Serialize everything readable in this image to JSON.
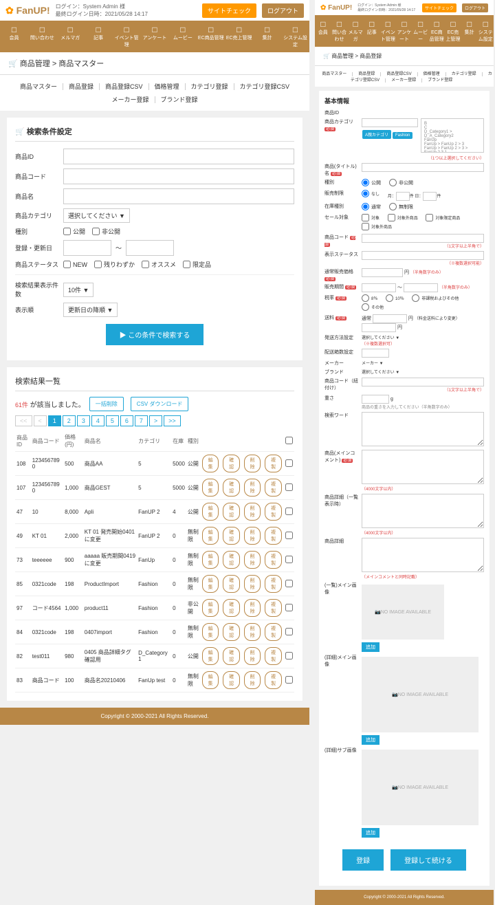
{
  "header": {
    "logo": "FanUP!",
    "login_user": "ログイン：System Admin 様",
    "login_time": "最終ログイン日時：2021/05/28 14:17",
    "btn_check": "サイトチェック",
    "btn_logout": "ログアウト"
  },
  "nav": [
    "会員",
    "問い合わせ",
    "メルマガ",
    "記事",
    "イベント管理",
    "アンケート",
    "ムービー",
    "EC商品管理",
    "EC売上管理",
    "集計",
    "システム設定"
  ],
  "breadcrumb": "商品管理 > 商品マスター",
  "tabs_row1": [
    "商品マスター",
    "商品登録",
    "商品登録CSV",
    "価格管理",
    "カテゴリ登録",
    "カテゴリ登録CSV"
  ],
  "tabs_row2": [
    "メーカー登録",
    "ブランド登録"
  ],
  "search": {
    "title": "検索条件設定",
    "l_id": "商品ID",
    "l_code": "商品コード",
    "l_name": "商品名",
    "l_cat": "商品カテゴリ",
    "cat_ph": "選択してください ▼",
    "l_type": "種別",
    "type_pub": "公開",
    "type_unpub": "非公開",
    "l_date": "登録・更新日",
    "dash": "〜",
    "l_status": "商品ステータス",
    "st_new": "NEW",
    "st_few": "残りわずか",
    "st_rec": "オススメ",
    "st_lim": "限定品",
    "l_count": "検索結果表示件数",
    "count_v": "10件 ▼",
    "l_sort": "表示順",
    "sort_v": "更新日の降順 ▼",
    "submit": "▶ この条件で検索する"
  },
  "results": {
    "title": "検索結果一覧",
    "hit_n": "61件",
    "hit_t": " が該当しました。",
    "btn_bulk": "一括削除",
    "btn_csv": "CSV ダウンロード",
    "pager": [
      "<<",
      "<",
      "1",
      "2",
      "3",
      "4",
      "5",
      "6",
      "7",
      ">",
      ">>"
    ],
    "cols": [
      "商品ID",
      "商品コード",
      "価格(円)",
      "商品名",
      "カテゴリ",
      "在庫",
      "種別"
    ],
    "btns": [
      "編集",
      "確認",
      "削除",
      "複製"
    ],
    "rows": [
      {
        "id": "108",
        "code": "123456789 0",
        "price": "500",
        "name": "商品AA",
        "cat": "5",
        "stock": "5000",
        "type": "公開"
      },
      {
        "id": "107",
        "code": "123456789 0",
        "price": "1,000",
        "name": "商品GEST",
        "cat": "5",
        "stock": "5000",
        "type": "公開"
      },
      {
        "id": "47",
        "code": "10",
        "price": "8,000",
        "name": "Apli",
        "cat": "FanUP 2",
        "stock": "4",
        "type": "公開"
      },
      {
        "id": "49",
        "code": "KT 01",
        "price": "2,000",
        "name": "KT 01 発売開始0401に変更",
        "cat": "FanUP 2",
        "stock": "0",
        "type": "無制限"
      },
      {
        "id": "73",
        "code": "teeeeee",
        "price": "900",
        "name": "aaaaa 販売期間0419に変更",
        "cat": "FanUp",
        "stock": "0",
        "type": "無制限"
      },
      {
        "id": "85",
        "code": "0321code",
        "price": "198",
        "name": "ProductImport",
        "cat": "Fashion",
        "stock": "0",
        "type": "無制限"
      },
      {
        "id": "97",
        "code": "コード4564",
        "price": "1,000",
        "name": "product11",
        "cat": "Fashion",
        "stock": "0",
        "type": "非公開"
      },
      {
        "id": "84",
        "code": "0321code",
        "price": "198",
        "name": "0407import",
        "cat": "Fashion",
        "stock": "0",
        "type": "無制限"
      },
      {
        "id": "82",
        "code": "test011",
        "price": "980",
        "name": "0405 商品詳細タグ確認用",
        "cat": "D_Category 1",
        "stock": "0",
        "type": "公開"
      },
      {
        "id": "83",
        "code": "商品コード",
        "price": "100",
        "name": "商品名20210406",
        "cat": "FanUp test",
        "stock": "0",
        "type": "無制限"
      }
    ]
  },
  "form2": {
    "bc": "商品管理 > 商品登録",
    "tabs": [
      "商品マスター",
      "商品登録",
      "商品登録CSV",
      "価格管理",
      "カテゴリ登録",
      "カテゴリ登録CSV",
      "メーカー登録",
      "ブランド登録"
    ],
    "title": "基本情報",
    "l_id": "商品ID",
    "l_cat": "商品カテゴリ",
    "cat_note": "（1つ以上選択してください）",
    "cat_opts": [
      "B",
      "C",
      "D_Category1 > D_A_Category2",
      "FanUp",
      "FanUp > FanUp 2 > 3",
      "FanUp > FanUp 2 > 3 > FanUp 2 3 1"
    ],
    "tags": [
      "A親カテゴリ",
      "Fashion"
    ],
    "l_name": "商品(タイトル)名",
    "l_type": "種別",
    "t_pub": "公開",
    "t_unpub": "非公開",
    "l_limit": "販売制限",
    "limit_a": "なし",
    "limit_b": "月：",
    "limit_c": "件",
    "limit_d": "日：",
    "limit_e": "件",
    "l_stock": "在庫種別",
    "stock_a": "通常",
    "stock_b": "無制限",
    "l_sale": "セール対象",
    "sale_a": "対象",
    "sale_b": "対象外商品",
    "sale_c": "対象限定商品",
    "sale_d": "対象外商品",
    "l_code": "商品コード",
    "code_note": "（1文字以上半角で）",
    "l_disp": "表示ステータス",
    "disp_note": "（※複数選択可能）",
    "l_price": "通常販売価格",
    "price_unit": "円",
    "price_note": "（半角数字のみ）",
    "l_period": "販売期間",
    "period_note": "（半角数字のみ）",
    "l_tax": "税率",
    "tax_a": "8％",
    "tax_b": "10％",
    "tax_c": "非課税およびその他",
    "tax_d": "その他",
    "l_ship": "送料",
    "ship_v": "通常",
    "ship_u": "円",
    "ship_note2": "（料金送料により変更）",
    "l_deliv": "発送方法設定",
    "deliv_sel": "選択してください ▼",
    "deliv_note": "（※複数選択可）",
    "l_group": "配送箱数設定",
    "l_maker": "メーカー",
    "maker_sel": "メーカー ▼",
    "l_brand": "ブランド",
    "brand_sel": "選択してください ▼",
    "l_rel": "商品コード（紐付け）",
    "rel_note": "（1文字以上半角で）",
    "l_weight": "重さ",
    "w_u": "g",
    "w_note": "商品の重さを入力してください（半角数字のみ）",
    "l_remark": "検索ワード",
    "l_comment": "商品(メインコメント)",
    "comment_note": "（4000文字以内）",
    "l_list": "商品詳細（一覧表示時）",
    "list_note": "（4000文字以内）",
    "l_detail": "商品詳細",
    "detail_note": "（メインコメントと同時記載）",
    "l_listimg": "(一覧)メイン画像",
    "l_mainimg": "(詳細)メイン画像",
    "l_subimg": "(詳細)サブ画像",
    "noimg": "NO IMAGE AVAILABLE",
    "add": "追加",
    "btn_reg": "登録",
    "btn_cont": "登録して続ける"
  },
  "footer": "Copyright © 2000-2021 All Rights Reserved."
}
